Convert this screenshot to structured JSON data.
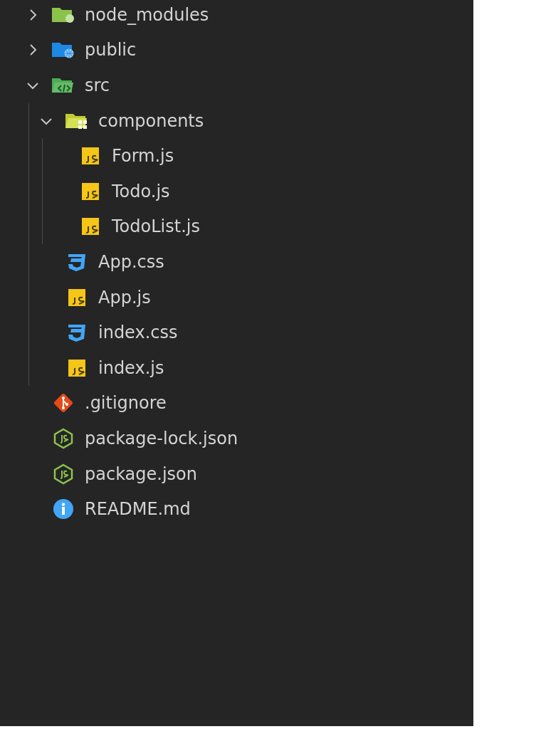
{
  "tree": [
    {
      "kind": "node",
      "name": "node_modules",
      "expanded": false
    },
    {
      "kind": "public",
      "name": "public",
      "expanded": false
    },
    {
      "kind": "src",
      "name": "src",
      "expanded": true,
      "children": [
        {
          "kind": "components",
          "name": "components",
          "expanded": true,
          "children": [
            {
              "kind": "js",
              "name": "Form.js"
            },
            {
              "kind": "js",
              "name": "Todo.js"
            },
            {
              "kind": "js",
              "name": "TodoList.js"
            }
          ]
        },
        {
          "kind": "css",
          "name": "App.css"
        },
        {
          "kind": "js",
          "name": "App.js"
        },
        {
          "kind": "css",
          "name": "index.css"
        },
        {
          "kind": "js",
          "name": "index.js"
        }
      ]
    },
    {
      "kind": "git",
      "name": ".gitignore"
    },
    {
      "kind": "npm",
      "name": "package-lock.json"
    },
    {
      "kind": "npm",
      "name": "package.json"
    },
    {
      "kind": "info",
      "name": "README.md"
    }
  ]
}
